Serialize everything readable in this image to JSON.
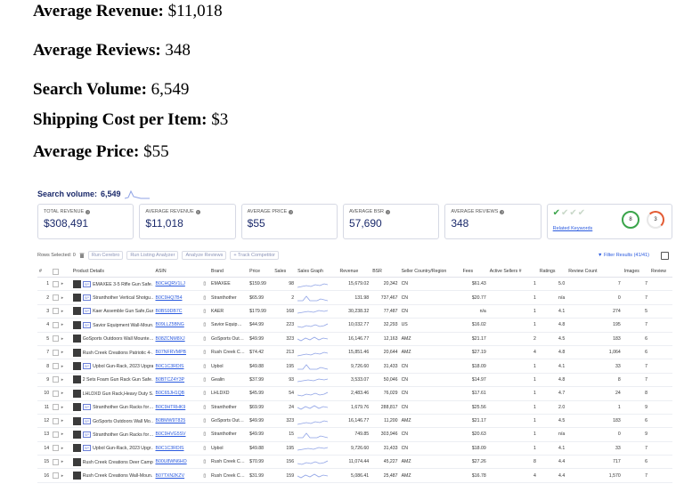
{
  "doc_lines": [
    {
      "label": "Average Revenue:",
      "value": "$11,018"
    },
    {
      "label": "Average Reviews:",
      "value": "348"
    },
    {
      "label": "Search Volume:",
      "value": "6,549"
    },
    {
      "label": "Shipping Cost per Item:",
      "value": "$3"
    },
    {
      "label": "Average Price:",
      "value": "$55"
    }
  ],
  "search_volume": {
    "label": "Search volume:",
    "value": "6,549"
  },
  "cards": [
    {
      "title": "TOTAL REVENUE",
      "value": "$308,491"
    },
    {
      "title": "AVERAGE REVENUE",
      "value": "$11,018"
    },
    {
      "title": "AVERAGE PRICE",
      "value": "$55"
    },
    {
      "title": "AVERAGE BSR",
      "value": "57,690"
    },
    {
      "title": "AVERAGE REVIEWS",
      "value": "348"
    }
  ],
  "keywords_card": {
    "related_label": "Related Keywords",
    "score_a": "8",
    "score_b": "3"
  },
  "toolbar": {
    "rows_selected": "Rows Selected: 0",
    "run_cerebro": "Run Cerebro",
    "run_listing": "Run Listing Analyzer",
    "analyze_reviews": "Analyze Reviews",
    "track_competitor": "+ Track Competitor",
    "filter_results": "Filter Results (41/41)"
  },
  "columns": [
    "#",
    "",
    "",
    "Product Details",
    "ASIN",
    "",
    "Brand",
    "Price",
    "Sales",
    "Sales Graph",
    "Revenue",
    "BSR",
    "Seller Country/Region",
    "Fees",
    "Active Sellers #",
    "Ratings",
    "Review Count",
    "Images",
    "Review"
  ],
  "rows": [
    {
      "n": "1",
      "sp": true,
      "name": "EMAXEE 3-5 Rifle Gun Safe…",
      "asin": "B0CHQRV1LJ",
      "brand": "EMAXEE",
      "price": "$159.99",
      "sales": "98",
      "revenue": "15,679.02",
      "bsr": "20,342",
      "country": "CN",
      "fees": "$61.43",
      "sellers": "1",
      "rating": "5.0",
      "reviews": "7",
      "images": "7"
    },
    {
      "n": "2",
      "sp": true,
      "name": "Stranthother Vertical Shotgu…",
      "asin": "B0C9HQ7B4",
      "brand": "Stranthother",
      "price": "$65.99",
      "sales": "2",
      "revenue": "131.98",
      "bsr": "737,467",
      "country": "CN",
      "fees": "$20.77",
      "sellers": "1",
      "rating": "n/a",
      "reviews": "0",
      "images": "7"
    },
    {
      "n": "3",
      "sp": true,
      "name": "Kaer Assemble Gun Safe,Gun…",
      "asin": "B0BS9DB7C",
      "brand": "KAER",
      "price": "$179.99",
      "sales": "168",
      "revenue": "30,238.32",
      "bsr": "77,487",
      "country": "CN",
      "fees": "n/a",
      "sellers": "1",
      "rating": "4.1",
      "reviews": "274",
      "images": "5"
    },
    {
      "n": "4",
      "sp": true,
      "name": "Savior Equipment Wall-Moun…",
      "asin": "B09LLZ5BNG",
      "brand": "Savior Equip…",
      "price": "$44.99",
      "sales": "223",
      "revenue": "10,032.77",
      "bsr": "32,293",
      "country": "US",
      "fees": "$16.02",
      "sellers": "1",
      "rating": "4.8",
      "reviews": "195",
      "images": "7"
    },
    {
      "n": "5",
      "sp": false,
      "name": "GoSports Outdoors Wall Mounte…",
      "asin": "B08ZCNM8XJ",
      "brand": "GoSports Out…",
      "price": "$49.99",
      "sales": "323",
      "revenue": "16,146.77",
      "bsr": "12,163",
      "country": "AMZ",
      "fees": "$21.17",
      "sellers": "2",
      "rating": "4.5",
      "reviews": "183",
      "images": "6"
    },
    {
      "n": "7",
      "sp": false,
      "name": "Rush Creek Creations Patriotic 4-…",
      "asin": "B07NFRVMPB",
      "brand": "Rush Creek C…",
      "price": "$74.42",
      "sales": "213",
      "revenue": "15,851.46",
      "bsr": "20,644",
      "country": "AMZ",
      "fees": "$27.19",
      "sellers": "4",
      "rating": "4.8",
      "reviews": "1,064",
      "images": "6"
    },
    {
      "n": "8",
      "sp": true,
      "name": "Upbol Gun-Rack, 2023 Upgrade…",
      "asin": "B0C1C3RDIS",
      "brand": "Upbol",
      "price": "$49.88",
      "sales": "195",
      "revenue": "9,726.60",
      "bsr": "31,433",
      "country": "CN",
      "fees": "$18.09",
      "sellers": "1",
      "rating": "4.1",
      "reviews": "33",
      "images": "7"
    },
    {
      "n": "9",
      "sp": false,
      "name": "2 Sets Foam Gun Rack Gun Safe…",
      "asin": "B0BTCZ4Y3P",
      "brand": "Gealin",
      "price": "$37.99",
      "sales": "93",
      "revenue": "3,533.07",
      "bsr": "50,046",
      "country": "CN",
      "fees": "$14.97",
      "sellers": "1",
      "rating": "4.8",
      "reviews": "8",
      "images": "7"
    },
    {
      "n": "10",
      "sp": false,
      "name": "LHLDXD Gun Rack,Heavy Duty S…",
      "asin": "B0C65JH1QB",
      "brand": "LHLDXD",
      "price": "$45.99",
      "sales": "54",
      "revenue": "2,483.46",
      "bsr": "76,029",
      "country": "CN",
      "fees": "$17.61",
      "sellers": "1",
      "rating": "4.7",
      "reviews": "24",
      "images": "8"
    },
    {
      "n": "11",
      "sp": true,
      "name": "Stranthother Gun Racks for…",
      "asin": "B0C9HTRHK9",
      "brand": "Stranthother",
      "price": "$69.99",
      "sales": "24",
      "revenue": "1,679.76",
      "bsr": "288,817",
      "country": "CN",
      "fees": "$25.56",
      "sellers": "1",
      "rating": "2.0",
      "reviews": "1",
      "images": "9"
    },
    {
      "n": "12",
      "sp": true,
      "name": "GoSports Outdoors Wall Mo…",
      "asin": "B0BMW9T825",
      "brand": "GoSports Out…",
      "price": "$49.99",
      "sales": "323",
      "revenue": "16,146.77",
      "bsr": "11,200",
      "country": "AMZ",
      "fees": "$21.17",
      "sellers": "1",
      "rating": "4.5",
      "reviews": "183",
      "images": "6"
    },
    {
      "n": "13",
      "sp": true,
      "name": "Stranthother Gun Racks for…",
      "asin": "B0C9HVG5SV",
      "brand": "Stranthother",
      "price": "$49.99",
      "sales": "15",
      "revenue": "749.85",
      "bsr": "303,946",
      "country": "CN",
      "fees": "$20.63",
      "sellers": "1",
      "rating": "n/a",
      "reviews": "0",
      "images": "9"
    },
    {
      "n": "14",
      "sp": true,
      "name": "Upbol Gun-Rack, 2023 Upgr…",
      "asin": "B0C1C3RDIS",
      "brand": "Upbol",
      "price": "$49.88",
      "sales": "195",
      "revenue": "9,726.60",
      "bsr": "31,433",
      "country": "CN",
      "fees": "$18.09",
      "sellers": "1",
      "rating": "4.1",
      "reviews": "33",
      "images": "7"
    },
    {
      "n": "15",
      "sp": false,
      "name": "Rush Creek Creations Deer Camp…",
      "asin": "B00U8WN6HO",
      "brand": "Rush Creek C…",
      "price": "$70.99",
      "sales": "156",
      "revenue": "11,074.44",
      "bsr": "45,227",
      "country": "AMZ",
      "fees": "$27.26",
      "sellers": "8",
      "rating": "4.4",
      "reviews": "717",
      "images": "6"
    },
    {
      "n": "16",
      "sp": false,
      "name": "Rush Creek Creations Wall-Moun…",
      "asin": "B07TXN2KZV",
      "brand": "Rush Creek C…",
      "price": "$31.99",
      "sales": "159",
      "revenue": "5,086.41",
      "bsr": "25,487",
      "country": "AMZ",
      "fees": "$16.78",
      "sellers": "4",
      "rating": "4.4",
      "reviews": "1,570",
      "images": "7"
    }
  ]
}
